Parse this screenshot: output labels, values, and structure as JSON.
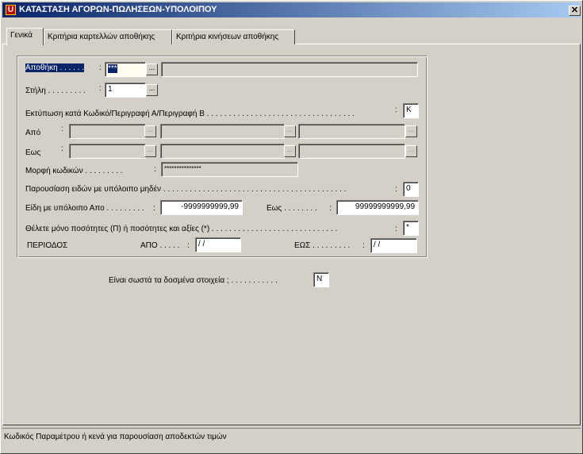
{
  "window": {
    "title": "ΚΑΤΑΣΤΑΣΗ ΑΓΟΡΩΝ-ΠΩΛΗΣΕΩΝ-ΥΠΟΛΟΙΠΟΥ",
    "icon": "app-icon",
    "close_label": "✕"
  },
  "tabs": [
    {
      "label": "Γενικά",
      "active": true
    },
    {
      "label": "Κριτήρια καρτελλών αποθήκης",
      "active": false
    },
    {
      "label": "Κριτήρια κινήσεων αποθήκης",
      "active": false
    }
  ],
  "form": {
    "warehouse": {
      "label": "Αποθήκη . . . . . .",
      "value": "***",
      "description": ""
    },
    "column": {
      "label": "Στήλη . . . . . . . . .",
      "value": "1"
    },
    "print_by": {
      "label": "Εκτύπωση κατά Κωδικό/Περιγραφή Α/Περιγραφή Β . . . . . . . . . . . . . . . . . . . . . . . . . . . . . . . . . .",
      "value": "K"
    },
    "from": {
      "label": "Από",
      "values": [
        "",
        "",
        ""
      ]
    },
    "to": {
      "label": "Εως",
      "values": [
        "",
        "",
        ""
      ]
    },
    "code_format": {
      "label": "Μορφή κωδικών . . . . . . . . .",
      "value": "***************"
    },
    "zero_balance": {
      "label": "Παρουσίαση ειδών με υπόλοιπο μηδέν . . . . . . . . . . . . . . . . . . . . . . . . . . . . . . . . . . . . . . . . . .",
      "value": "0"
    },
    "balance_from": {
      "label": "Είδη με υπόλοιπο Απο . . . . . . . . .",
      "value": "-9999999999,99"
    },
    "balance_to": {
      "label": "Εως . . . . . . . .",
      "value": "99999999999,99"
    },
    "qty_or_values": {
      "label": "Θέλετε μόνο ποσότητες (Π) ή ποσότητες και αξίες (*) . . . . . . . . . . . . . . . . . . . . . . . . . . . . .",
      "value": "*"
    },
    "period": {
      "label": "ΠΕΡΙΟΔΟΣ",
      "from_label": "ΑΠΟ . . . . .",
      "from_value": " / /",
      "to_label": "ΕΩΣ . . . . . . . . .",
      "to_value": " / /"
    },
    "ellipsis": "...",
    "colon": ":"
  },
  "confirm": {
    "label": "Είναι σωστά τα δοσμένα στοιχεία ; . . . . . . . . . . .",
    "value": "N"
  },
  "status_bar": {
    "text": "Κωδικός Παραμέτρου ή κενά για παρουσίαση αποδεκτών τιμών"
  },
  "colors": {
    "title_start": "#0a246a",
    "title_end": "#a6caf0",
    "face": "#d4d0c8"
  }
}
